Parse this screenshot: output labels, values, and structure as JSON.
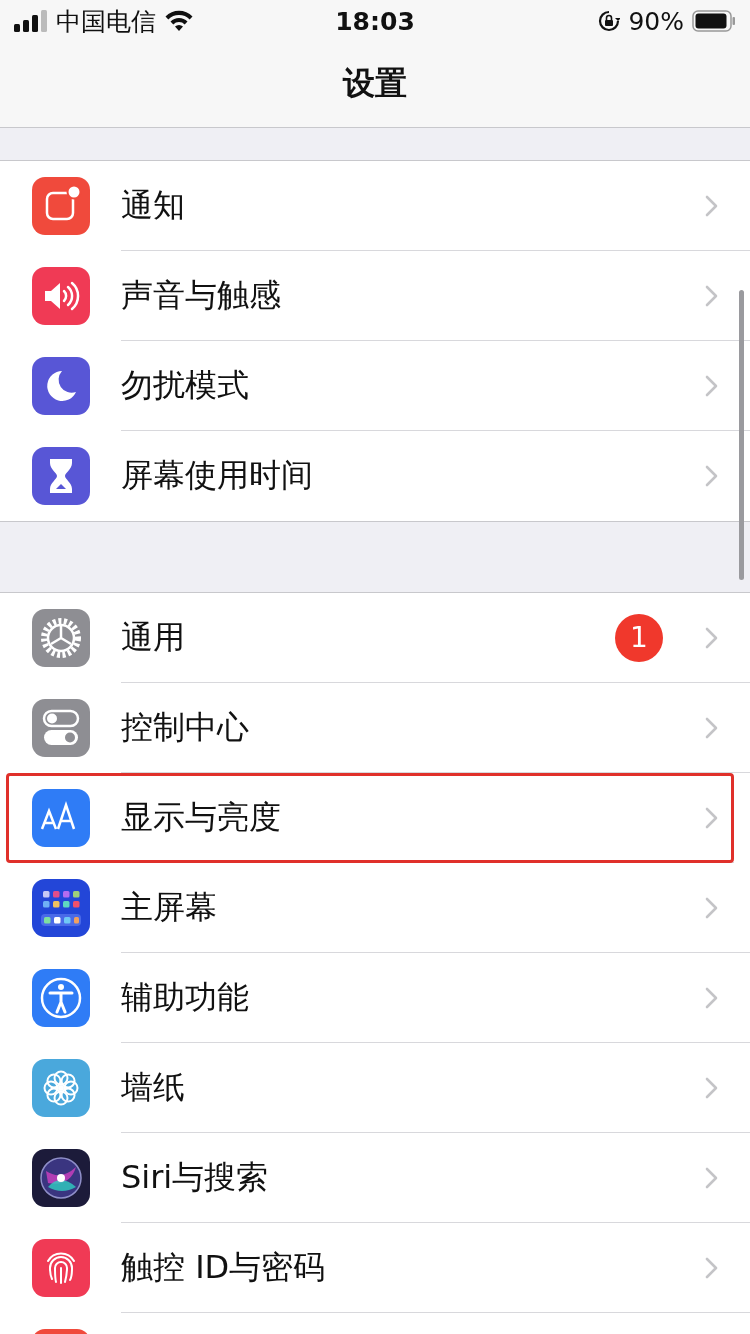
{
  "status_bar": {
    "carrier": "中国电信",
    "time": "18:03",
    "battery": "90%"
  },
  "nav": {
    "title": "设置"
  },
  "groups": [
    {
      "items": [
        {
          "kind": "notifications",
          "label": "通知",
          "highlighted": false
        },
        {
          "kind": "sounds",
          "label": "声音与触感",
          "highlighted": false
        },
        {
          "kind": "moon",
          "label": "勿扰模式",
          "highlighted": false
        },
        {
          "kind": "hourglass",
          "label": "屏幕使用时间",
          "highlighted": false
        }
      ]
    },
    {
      "items": [
        {
          "kind": "gear",
          "label": "通用",
          "badge": "1",
          "highlighted": false
        },
        {
          "kind": "toggles",
          "label": "控制中心",
          "highlighted": false
        },
        {
          "kind": "display",
          "label": "显示与亮度",
          "highlighted": true
        },
        {
          "kind": "home",
          "label": "主屏幕",
          "highlighted": false
        },
        {
          "kind": "accessibility",
          "label": "辅助功能",
          "highlighted": false
        },
        {
          "kind": "flower",
          "label": "墙纸",
          "highlighted": false
        },
        {
          "kind": "siri",
          "label": "Siri与搜索",
          "highlighted": false
        },
        {
          "kind": "fingerprint",
          "label": "触控 ID与密码",
          "highlighted": false
        },
        {
          "kind": "sos",
          "highlighted": false
        }
      ]
    }
  ]
}
